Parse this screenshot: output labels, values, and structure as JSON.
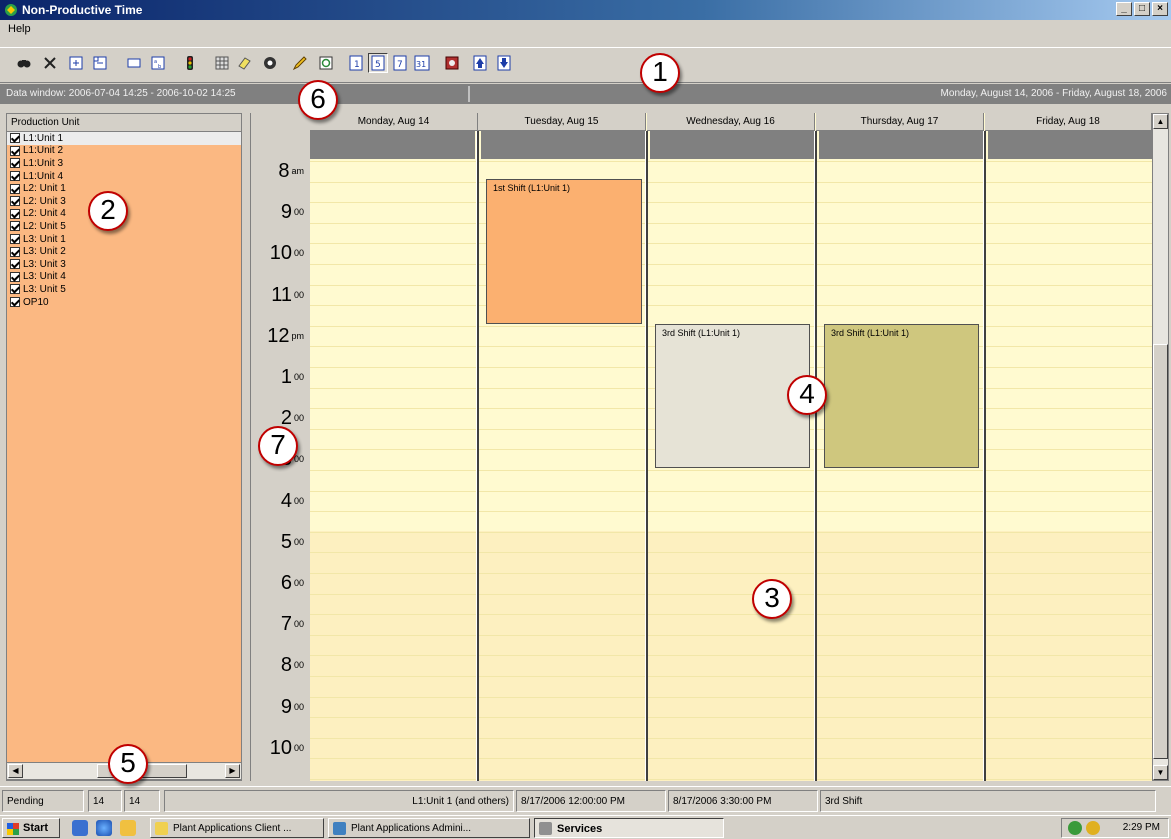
{
  "window": {
    "title": "Non-Productive Time",
    "btn_min": "_",
    "btn_max": "□",
    "btn_close": "×"
  },
  "menu": {
    "help": "Help"
  },
  "toolbar": {
    "buttons": [
      "find-icon",
      "delete-icon",
      "expand-icon",
      "collapse-icon",
      "rectangle-icon",
      "sort-icon",
      "traffic-light-icon",
      "grid-icon",
      "eraser-icon",
      "eye-icon",
      "pencil-icon",
      "refresh-icon",
      "day-view-icon",
      "week-view-icon",
      "seven-day-view-icon",
      "month-view-icon",
      "record-icon",
      "move-up-icon",
      "move-down-icon"
    ],
    "view_labels": {
      "day": "1",
      "week": "5",
      "seven": "7",
      "month": "31"
    }
  },
  "data_window": {
    "left": "Data window: 2006-07-04 14:25 - 2006-10-02 14:25",
    "right": "Monday, August 14, 2006 - Friday, August 18, 2006"
  },
  "units": {
    "header": "Production Unit",
    "items": [
      "L1:Unit 1",
      "L1:Unit 2",
      "L1:Unit 3",
      "L1:Unit 4",
      "L2: Unit 1",
      "L2: Unit 3",
      "L2: Unit 4",
      "L2: Unit 5",
      "L3: Unit 1",
      "L3: Unit 2",
      "L3: Unit 3",
      "L3: Unit 4",
      "L3: Unit 5",
      "OP10"
    ]
  },
  "time_labels": [
    {
      "h": "8",
      "s": "am"
    },
    {
      "h": "9",
      "s": "00"
    },
    {
      "h": "10",
      "s": "00"
    },
    {
      "h": "11",
      "s": "00"
    },
    {
      "h": "12",
      "s": "pm"
    },
    {
      "h": "1",
      "s": "00"
    },
    {
      "h": "2",
      "s": "00"
    },
    {
      "h": "3",
      "s": "00"
    },
    {
      "h": "4",
      "s": "00"
    },
    {
      "h": "5",
      "s": "00"
    },
    {
      "h": "6",
      "s": "00"
    },
    {
      "h": "7",
      "s": "00"
    },
    {
      "h": "8",
      "s": "00"
    },
    {
      "h": "9",
      "s": "00"
    },
    {
      "h": "10",
      "s": "00"
    }
  ],
  "days": [
    "Monday, Aug 14",
    "Tuesday, Aug 15",
    "Wednesday, Aug 16",
    "Thursday, Aug 17",
    "Friday, Aug 18"
  ],
  "events": [
    {
      "title": "1st Shift (L1:Unit 1)",
      "color": "#fbb070"
    },
    {
      "title": "3rd Shift (L1:Unit 1)",
      "color": "#e6e3d6"
    },
    {
      "title": "3rd Shift (L1:Unit 1)",
      "color": "#cfc77e"
    }
  ],
  "status": {
    "state": "Pending",
    "count1": "14",
    "count2": "14",
    "unit": "L1:Unit 1 (and others)",
    "start": "8/17/2006 12:00:00 PM",
    "end": "8/17/2006 3:30:00 PM",
    "shift": "3rd Shift"
  },
  "taskbar": {
    "start": "Start",
    "tasks": [
      "Plant Applications Client ...",
      "Plant Applications Admini...",
      "Services"
    ],
    "clock": "2:29 PM"
  },
  "callouts": [
    "1",
    "2",
    "3",
    "4",
    "5",
    "6",
    "7"
  ],
  "colors": {
    "unit_panel": "#fbb882",
    "calendar_bg": "#fffad0",
    "callout_border": "#c00000"
  }
}
